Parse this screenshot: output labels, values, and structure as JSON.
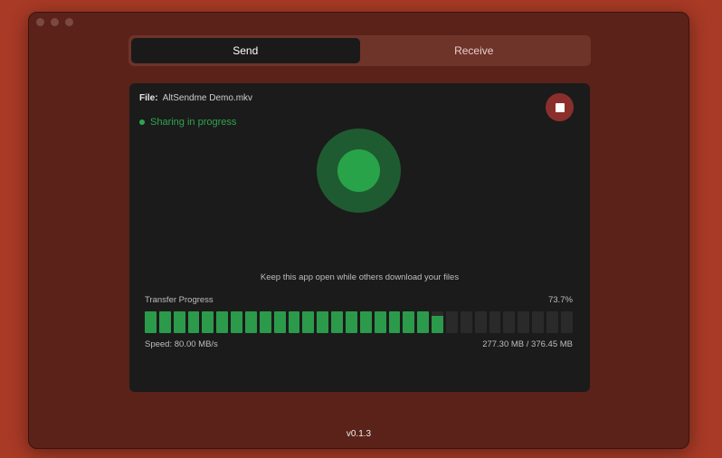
{
  "tabs": {
    "send": "Send",
    "receive": "Receive"
  },
  "file": {
    "label": "File:",
    "name": "AltSendme Demo.mkv"
  },
  "status": "Sharing in progress",
  "hint": "Keep this app open while others download your files",
  "progress": {
    "label": "Transfer Progress",
    "percent_text": "73.7%",
    "bar_fill": 0.69,
    "segments": 30,
    "speed": "Speed: 80.00 MB/s",
    "size": "277.30 MB / 376.45 MB"
  },
  "version": "v0.1.3",
  "colors": {
    "accent": "#2ea44f",
    "stop": "#8b2f2c"
  }
}
